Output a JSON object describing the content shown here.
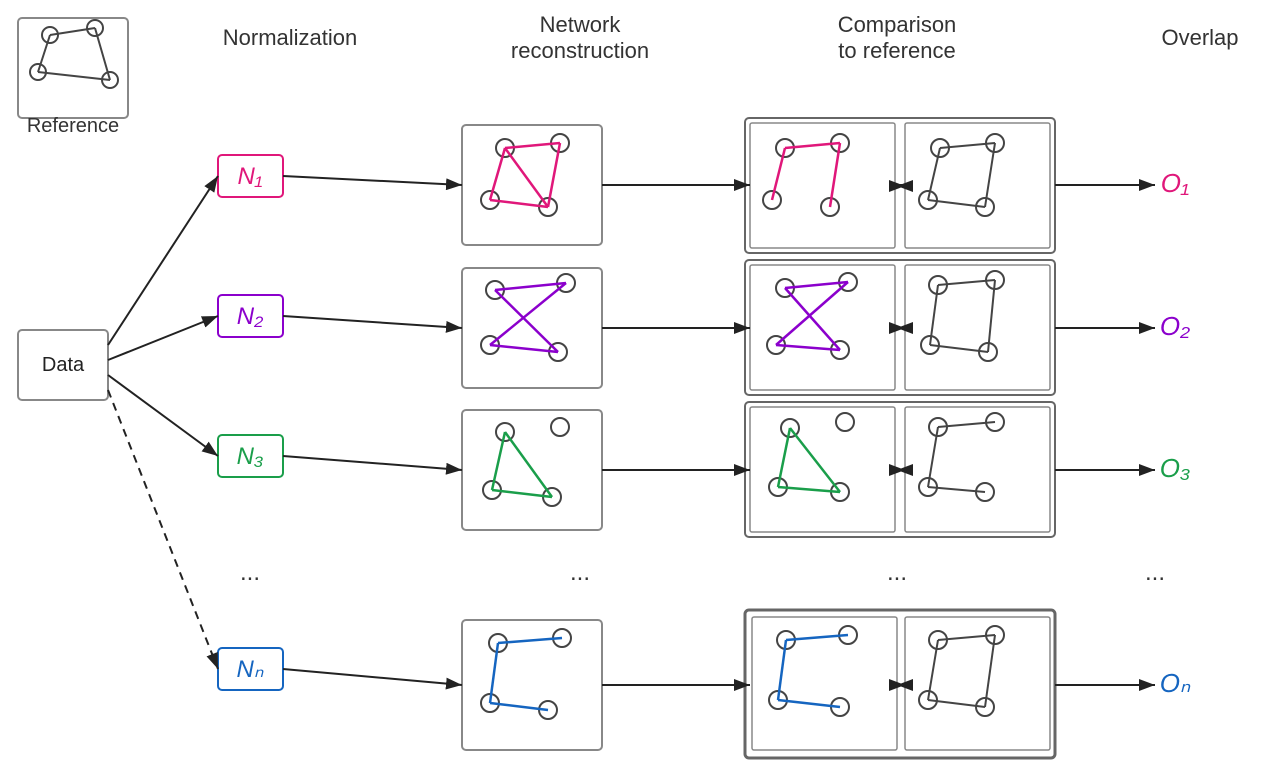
{
  "headers": {
    "normalization": "Normalization",
    "network_reconstruction": "Network\nreconstruction",
    "comparison_to_reference": "Comparison\nto reference",
    "overlap": "Overlap"
  },
  "labels": {
    "reference": "Reference",
    "data": "Data",
    "n1": "N₁",
    "n2": "N₂",
    "n3": "N₃",
    "nn": "Nₙ",
    "o1": "O₁",
    "o2": "O₂",
    "o3": "O₃",
    "on": "Oₙ",
    "dots": "..."
  },
  "colors": {
    "pink": "#e0177a",
    "purple": "#8b00cc",
    "green": "#1a9e4a",
    "blue": "#1565c0",
    "black": "#1a1a1a",
    "box_border": "#555",
    "node_fill": "#fff",
    "node_stroke": "#444"
  }
}
